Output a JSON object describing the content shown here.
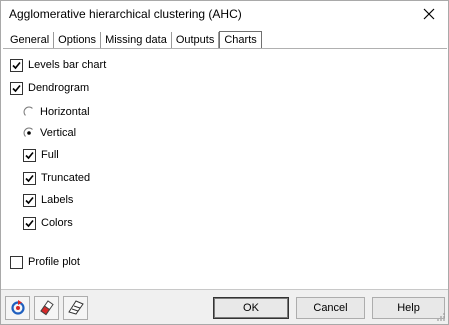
{
  "window": {
    "title": "Agglomerative hierarchical clustering (AHC)"
  },
  "tabs": [
    {
      "label": "General",
      "active": false
    },
    {
      "label": "Options",
      "active": false
    },
    {
      "label": "Missing data",
      "active": false
    },
    {
      "label": "Outputs",
      "active": false
    },
    {
      "label": "Charts",
      "active": true
    }
  ],
  "charts": {
    "levels_bar_chart": {
      "label": "Levels bar chart",
      "checked": true
    },
    "dendrogram": {
      "label": "Dendrogram",
      "checked": true
    },
    "orientation": {
      "horizontal": {
        "label": "Horizontal",
        "selected": false
      },
      "vertical": {
        "label": "Vertical",
        "selected": true
      }
    },
    "full": {
      "label": "Full",
      "checked": true
    },
    "truncated": {
      "label": "Truncated",
      "checked": true
    },
    "labels": {
      "label": "Labels",
      "checked": true
    },
    "colors": {
      "label": "Colors",
      "checked": true
    },
    "profile_plot": {
      "label": "Profile plot",
      "checked": false
    }
  },
  "footer": {
    "ok_label": "OK",
    "cancel_label": "Cancel",
    "help_label": "Help",
    "icons": [
      "reset-icon",
      "eraser-icon",
      "output-selection-icon"
    ]
  },
  "colors": {
    "ok_border": "#333333",
    "check": "#000000",
    "reset_red": "#d62828",
    "reset_blue": "#1f5fbf"
  }
}
